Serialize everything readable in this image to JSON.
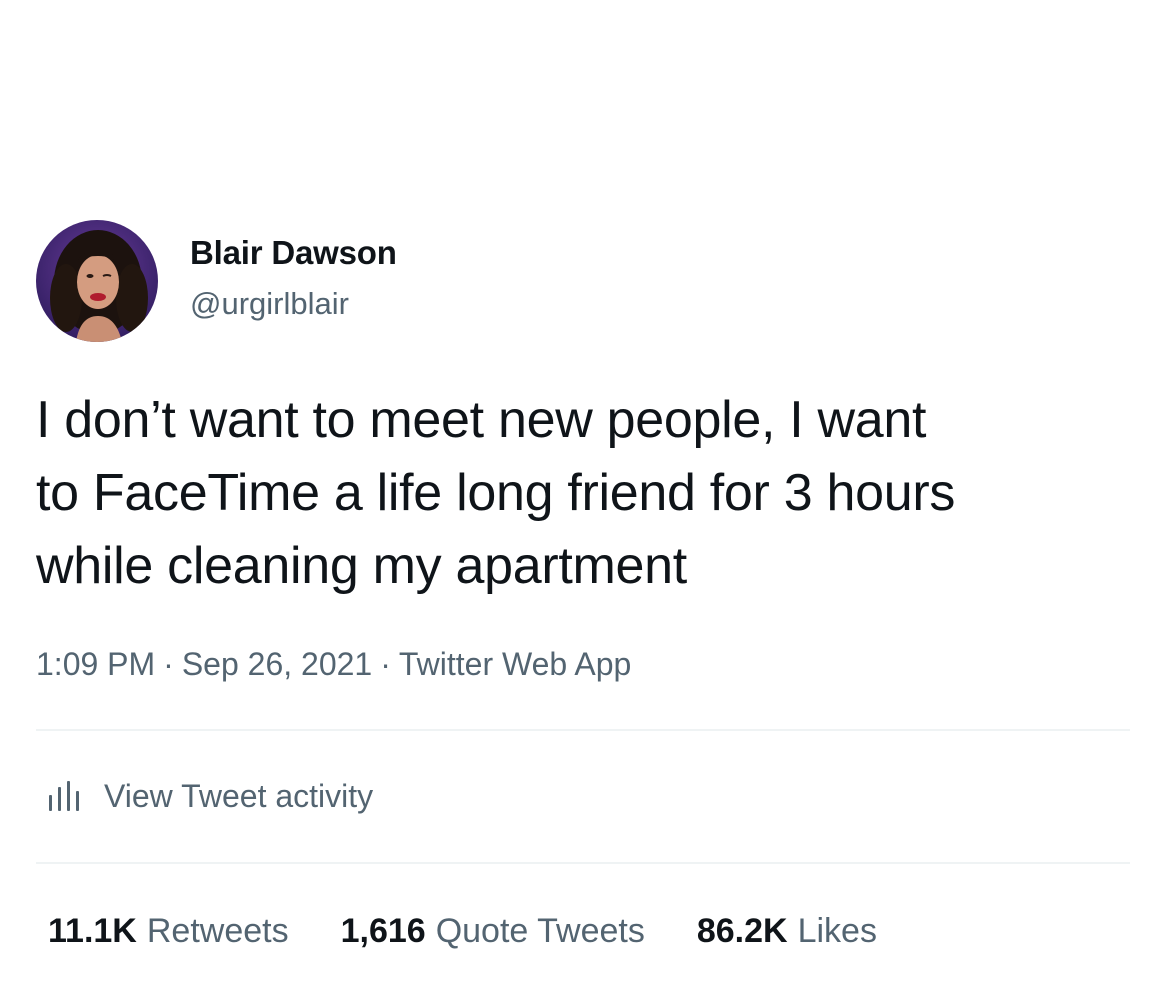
{
  "author": {
    "display_name": "Blair Dawson",
    "handle": "@urgirlblair",
    "avatar": "profile-photo"
  },
  "tweet": {
    "text_lines": [
      "I don’t want to meet new people, I want",
      "to FaceTime a life long friend for 3 hours",
      "while cleaning my apartment"
    ],
    "time": "1:09 PM",
    "separator": "·",
    "date": "Sep 26, 2021",
    "source": "Twitter Web App"
  },
  "activity": {
    "icon": "bar-chart-icon",
    "label": "View Tweet activity"
  },
  "stats": {
    "retweets_count": "11.1K",
    "retweets_label": "Retweets",
    "quotes_count": "1,616",
    "quotes_label": "Quote Tweets",
    "likes_count": "86.2K",
    "likes_label": "Likes"
  },
  "colors": {
    "text_primary": "#0f1419",
    "text_secondary": "#536471",
    "divider": "#eff3f4",
    "background": "#ffffff"
  }
}
